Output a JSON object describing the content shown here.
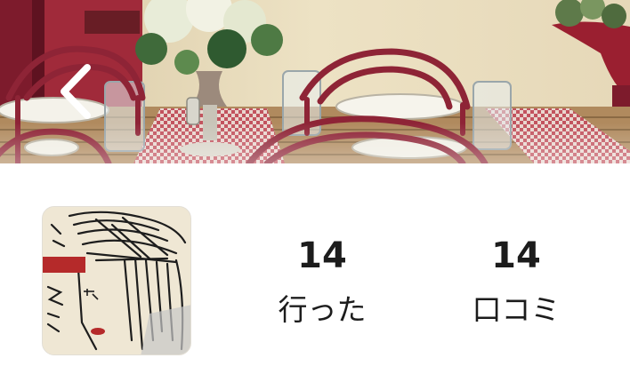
{
  "header": {
    "cover_image": "restaurant-tables-photo",
    "back_icon": "chevron-left-icon"
  },
  "profile": {
    "avatar_image": "sketch-drawing-avatar",
    "stats": [
      {
        "count": "14",
        "label": "行った"
      },
      {
        "count": "14",
        "label": "口コミ"
      }
    ]
  },
  "colors": {
    "background": "#ffffff",
    "text": "#1c1c1c",
    "chair_red": "#8e2436",
    "tablecloth_red": "#c2535e"
  }
}
